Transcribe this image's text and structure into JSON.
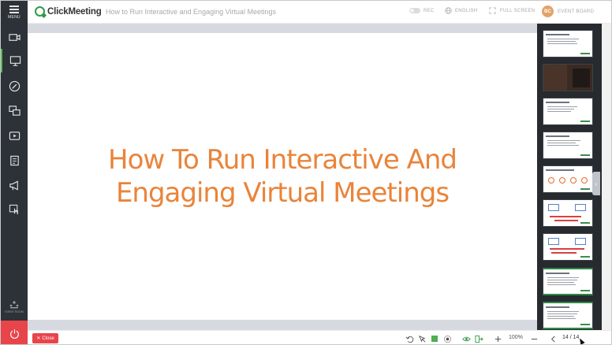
{
  "sidebar": {
    "menu_label": "MENU",
    "items": [
      {
        "icon": "video-camera-icon"
      },
      {
        "icon": "presentation-icon"
      },
      {
        "icon": "whiteboard-pen-icon"
      },
      {
        "icon": "screen-share-icon"
      },
      {
        "icon": "video-play-icon"
      },
      {
        "icon": "polls-icon"
      },
      {
        "icon": "cta-megaphone-icon"
      },
      {
        "icon": "touch-interaction-icon"
      }
    ],
    "event_room_label": "EVENT ROOM",
    "power_icon": "power-icon"
  },
  "topbar": {
    "brand": "ClickMeeting",
    "title": "How to Run Interactive and Engaging Virtual Meetings",
    "rec_label": "REC",
    "language_label": "ENGLISH",
    "fullscreen_label": "FULL SCREEN",
    "avatar_initials": "BC",
    "event_board_label": "EVENT BOARD"
  },
  "slide": {
    "title": "How To Run Interactive And Engaging Virtual Meetings"
  },
  "bottombar": {
    "close_label": "Close",
    "zoom": "100%",
    "page": "14 / 14"
  },
  "colors": {
    "accent": "#2e9b46",
    "slide_title": "#e9843a",
    "danger": "#e8454b",
    "sidebar_bg": "#2d3238"
  }
}
